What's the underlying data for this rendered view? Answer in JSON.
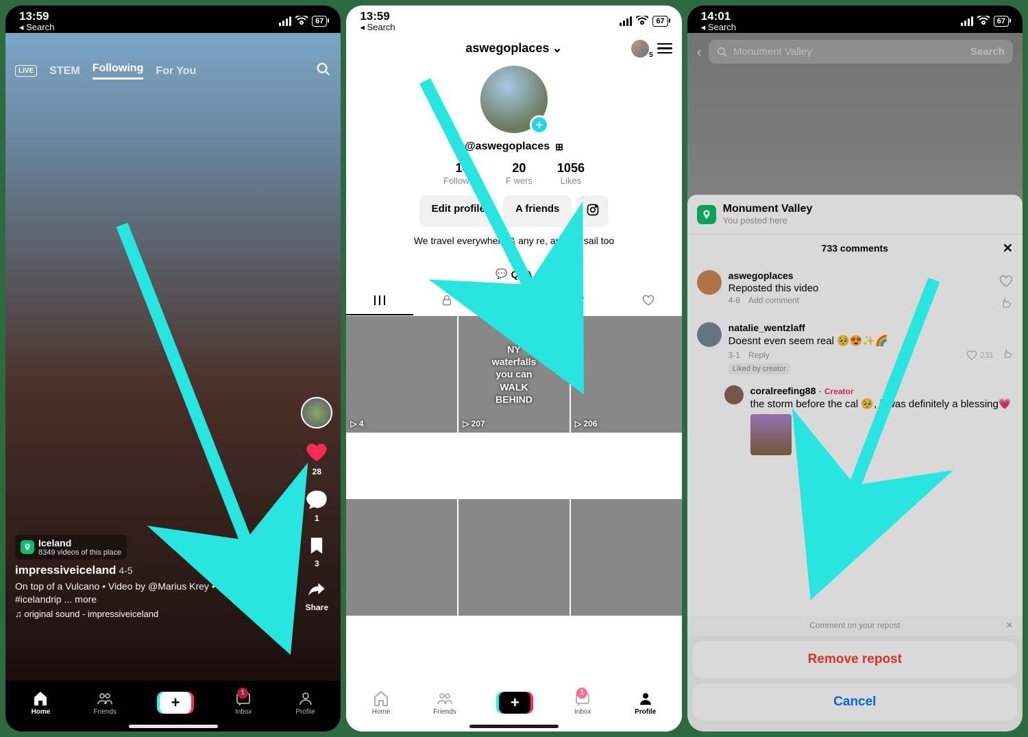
{
  "status": {
    "time1": "13:59",
    "time2": "13:59",
    "time3": "14:01",
    "back": "Search",
    "battery": "67"
  },
  "s1": {
    "tabs": {
      "live": "LIVE",
      "stem": "STEM",
      "following": "Following",
      "foryou": "For You"
    },
    "likes": "28",
    "comments": "1",
    "saves": "3",
    "share": "Share",
    "location": "Iceland",
    "loc_sub": "8349 videos of this place",
    "user": "impressiveiceland",
    "date": "4-5",
    "caption": "On top of a Vulcano • Video by @Marius Krey • • #iceland #icelandrip ... more",
    "sound": "♫ original sound - impressiveiceland"
  },
  "s2": {
    "username": "aswegoplaces",
    "notif": "5",
    "handle": "@aswegoplaces",
    "following_n": "14",
    "following_l": "Following",
    "followers_n": "20",
    "followers_l": "F    wers",
    "likes_n": "1056",
    "likes_l": "Likes",
    "edit": "Edit profile",
    "addf": "A    friends",
    "bio": "We travel everywhere & any    re, and we sail too",
    "qa": "Q&A",
    "grid": [
      {
        "plays": "▷ 4",
        "ov": ""
      },
      {
        "plays": "▷ 207",
        "ov": "NY waterfalls you can WALK BEHIND"
      },
      {
        "plays": "▷ 206",
        "ov": ""
      },
      {
        "plays": "",
        "ov": ""
      },
      {
        "plays": "",
        "ov": ""
      },
      {
        "plays": "",
        "ov": ""
      }
    ],
    "inbox_badge": "1"
  },
  "s3": {
    "search": "Monument Valley",
    "go": "Search",
    "loc": "Monument Valley",
    "posted": "You posted here",
    "cm_count": "733 comments",
    "c1": {
      "u": "aswegoplaces",
      "t": "Reposted this video",
      "d": "4-8",
      "add": "Add comment"
    },
    "c2": {
      "u": "natalie_wentzlaff",
      "t": "Doesnt even seem real 🥺😍✨🌈",
      "d": "3-1",
      "reply": "Reply",
      "likes": "231",
      "lbc": "Liked by creator"
    },
    "c3": {
      "u": "coralreefing88",
      "tag": "Creator",
      "t": "the storm before the cal   🥺, it was definitely a blessing💗"
    },
    "repost_hint": "Comment on your repost",
    "remove": "Remove repost",
    "cancel": "Cancel"
  },
  "nav": {
    "home": "Home",
    "friends": "Friends",
    "inbox": "Inbox",
    "profile": "Profile",
    "badge": "1"
  }
}
